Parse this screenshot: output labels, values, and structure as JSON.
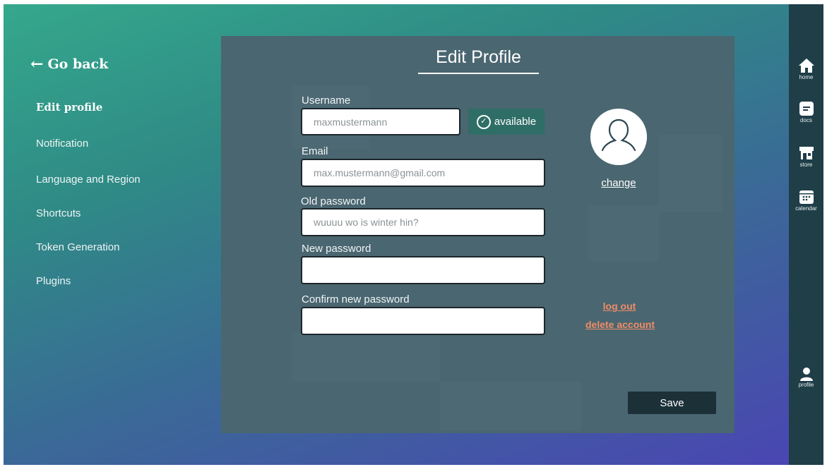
{
  "back": {
    "label": "Go back"
  },
  "sidebar": {
    "items": [
      {
        "label": "Edit profile",
        "active": true
      },
      {
        "label": "Notification"
      },
      {
        "label": "Language and Region"
      },
      {
        "label": "Shortcuts"
      },
      {
        "label": "Token Generation"
      },
      {
        "label": "Plugins"
      }
    ]
  },
  "form": {
    "title": "Edit Profile",
    "username": {
      "label": "Username",
      "placeholder": "maxmustermann",
      "status": "available"
    },
    "email": {
      "label": "Email",
      "placeholder": "max.mustermann@gmail.com"
    },
    "old_password": {
      "label": "Old password",
      "placeholder": "wuuuu wo is winter hin?"
    },
    "new_password": {
      "label": "New password",
      "placeholder": ""
    },
    "confirm_password": {
      "label": "Confirm new password",
      "placeholder": ""
    },
    "save_label": "Save"
  },
  "profile": {
    "change_label": "change",
    "logout_label": "log out",
    "delete_label": "delete account"
  },
  "rail": {
    "items": [
      {
        "label": "home",
        "icon": "home-icon"
      },
      {
        "label": "docs",
        "icon": "docs-icon"
      },
      {
        "label": "store",
        "icon": "store-icon"
      },
      {
        "label": "calendar",
        "icon": "calendar-icon"
      },
      {
        "label": "profile",
        "icon": "profile-icon"
      }
    ]
  },
  "colors": {
    "accent_link": "#f08d67",
    "available_badge": "#2f6e66",
    "rail_bg": "#1f3e48",
    "panel_bg": "#4a6670"
  }
}
